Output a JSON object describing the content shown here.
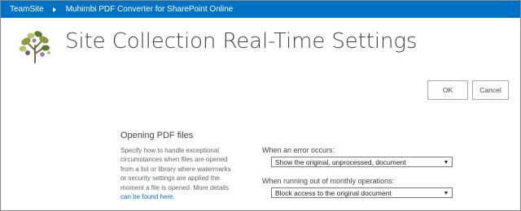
{
  "breadcrumb": {
    "site": "TeamSite",
    "app": "Muhimbi PDF Converter for SharePoint Online"
  },
  "page": {
    "title": "Site Collection Real-Time Settings"
  },
  "actions": {
    "ok_label": "OK",
    "cancel_label": "Cancel"
  },
  "section": {
    "title": "Opening PDF files",
    "description": "Specify how to handle exceptional circumstances when files are opened from a list or library where watermarks or security settings are applied the moment a file is opened. More details ",
    "link_text": "can be found here",
    "link_suffix": "."
  },
  "fields": {
    "error": {
      "label": "When an error occurs:",
      "selected": "Show the original, unprocessed, document"
    },
    "operations": {
      "label": "When running out of monthly operations:",
      "selected": "Block access to the original document"
    }
  },
  "colors": {
    "topbar": "#0072c6",
    "link": "#0072c6",
    "logo_leaves": [
      "#8b9b3c",
      "#5f7a2e",
      "#b8c46a",
      "#7a5a8c",
      "#a07ab0"
    ]
  }
}
